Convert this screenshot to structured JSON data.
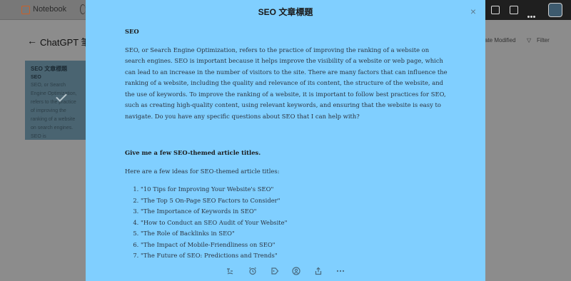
{
  "app": {
    "name": "Notebook",
    "heading": "ChatGPT 筆",
    "sort_label": "ate Modified",
    "filter_label": "Filter"
  },
  "card": {
    "title": "SEO 文章標題",
    "subtitle": "SEO",
    "preview": "SEO, or Search Engine Optimization, refers to the practice of improving the ranking of a website on search engines. SEO is"
  },
  "modal": {
    "title": "SEO 文章標題",
    "q1": "SEO",
    "a1": "SEO, or Search Engine Optimization, refers to the practice of improving the ranking of a website on search engines. SEO is important because it helps improve the visibility of a website or web page, which can lead to an increase in the number of visitors to the site. There are many factors that can influence the ranking of a website, including the quality and relevance of its content, the structure of the website, and the use of keywords. To improve the ranking of a website, it is important to follow best practices for SEO, such as creating high-quality content, using relevant keywords, and ensuring that the website is easy to navigate. Do you have any specific questions about SEO that I can help with?",
    "q2": "Give me a few SEO-themed article titles.",
    "a2_intro": "Here are a few ideas for SEO-themed article titles:",
    "titles": [
      "\"10 Tips for Improving Your Website's SEO\"",
      "\"The Top 5 On-Page SEO Factors to Consider\"",
      "\"The Importance of Keywords in SEO\"",
      "\"How to Conduct an SEO Audit of Your Website\"",
      "\"The Role of Backlinks in SEO\"",
      "\"The Impact of Mobile-Friendliness on SEO\"",
      "\"The Future of SEO: Predictions and Trends\""
    ]
  },
  "icons": {
    "close": "×",
    "back": "←",
    "filter": "filter-icon"
  }
}
